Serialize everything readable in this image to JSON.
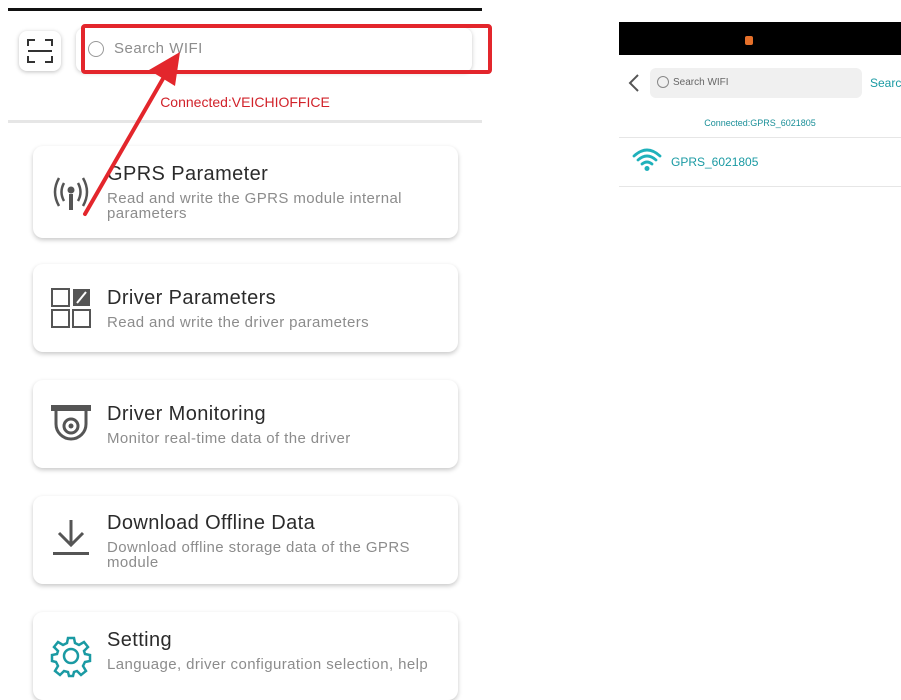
{
  "left": {
    "search": {
      "placeholder": "Search WIFI"
    },
    "connected_status": "Connected:VEICHIOFFICE",
    "menu": [
      {
        "title": "GPRS Parameter",
        "description": "Read and write the GPRS module internal parameters",
        "icon": "antenna-icon"
      },
      {
        "title": "Driver Parameters",
        "description": "Read and write the driver parameters",
        "icon": "grid-edit-icon"
      },
      {
        "title": "Driver Monitoring",
        "description": "Monitor real-time data of the driver",
        "icon": "camera-monitor-icon"
      },
      {
        "title": "Download Offline Data",
        "description": "Download offline storage data of the GPRS module",
        "icon": "download-icon"
      },
      {
        "title": "Setting",
        "description": "Language, driver configuration selection, help",
        "icon": "gear-icon"
      }
    ]
  },
  "right": {
    "search": {
      "placeholder": "Search WIFI"
    },
    "search_button": "Searc",
    "connected_status": "Connected:GPRS_6021805",
    "networks": [
      {
        "ssid": "GPRS_6021805"
      }
    ]
  },
  "colors": {
    "highlight": "#e3262c",
    "connected_left": "#d1222a",
    "teal": "#1a9aa3"
  }
}
